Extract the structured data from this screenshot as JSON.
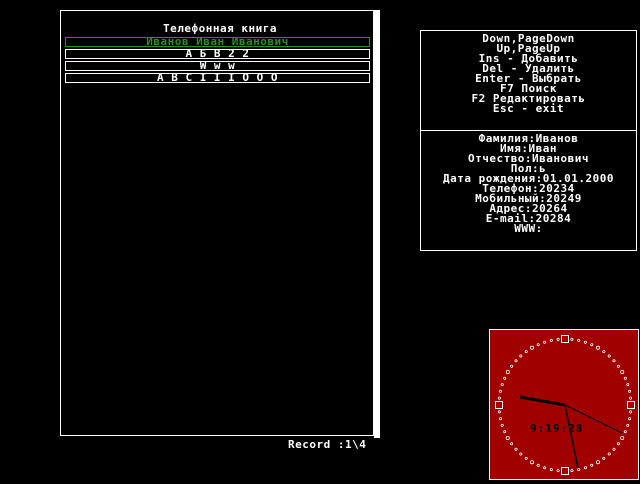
{
  "phonebook": {
    "title": "Телефонная книга",
    "records": [
      "Иванов Иван Иванович",
      "А Б В 2 2",
      "W w w",
      "A B C I I I O O O"
    ],
    "selected_index": 0,
    "record_status": "Record :1\\4"
  },
  "help": {
    "lines": [
      "Down,PageDown",
      "Up,PageUp",
      "Ins - Добавить",
      "Del - Удалить",
      "Enter - Выбрать",
      "F7 Поиск",
      "F2 Редактировать",
      "Esc - exit"
    ]
  },
  "details": {
    "lines": [
      "Фамилия:Иванов",
      "Имя:Иван",
      "Отчество:Иванович",
      "Пол:ь",
      "Дата рождения:01.01.2000",
      "Телефон:20234",
      "Мобильный:20249",
      "Адрес:20264",
      "E-mail:20284",
      "WWW:"
    ]
  },
  "clock": {
    "time": "9:19:28"
  },
  "colors": {
    "background": "#000000",
    "foreground": "#ffffff",
    "selected_record": "#2e8b2e",
    "clock_face": "#a10000"
  }
}
